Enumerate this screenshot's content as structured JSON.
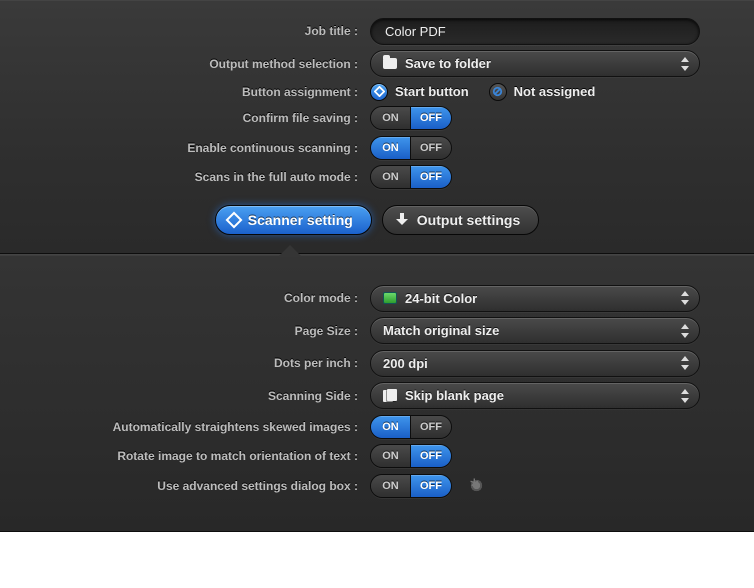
{
  "labels": {
    "job_title": "Job title :",
    "output_method": "Output method selection :",
    "button_assignment": "Button assignment :",
    "confirm_saving": "Confirm file saving :",
    "continuous": "Enable continuous scanning :",
    "full_auto": "Scans in the full auto mode :",
    "color_mode": "Color mode :",
    "page_size": "Page Size :",
    "dpi": "Dots per inch :",
    "scanning_side": "Scanning Side :",
    "straighten": "Automatically straightens skewed images :",
    "rotate": "Rotate image to match orientation of text :",
    "advanced": "Use advanced settings dialog box :"
  },
  "tabs": {
    "scanner": "Scanner setting",
    "output": "Output settings"
  },
  "job_title_value": "Color PDF",
  "output_method_value": "Save to folder",
  "radios": {
    "start": "Start button",
    "not_assigned": "Not assigned"
  },
  "toggle": {
    "on": "ON",
    "off": "OFF"
  },
  "toggles": {
    "confirm_saving": "OFF",
    "continuous": "ON",
    "full_auto": "OFF",
    "straighten": "ON",
    "rotate": "OFF",
    "advanced": "OFF"
  },
  "color_mode_value": "24-bit Color",
  "page_size_value": "Match original size",
  "dpi_value": "200 dpi",
  "scanning_side_value": "Skip blank page"
}
